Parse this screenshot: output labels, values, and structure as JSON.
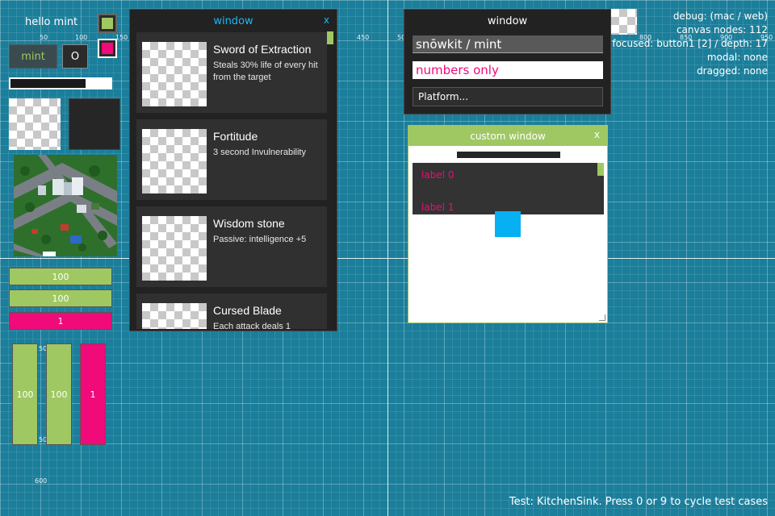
{
  "canvas": {
    "ticks": [
      "50",
      "100",
      "150",
      "450",
      "50",
      "800",
      "850",
      "900",
      "950",
      "50",
      "50",
      "600"
    ]
  },
  "left": {
    "hello_label": "hello mint",
    "check_green": true,
    "check_pink": true,
    "mint_button": "mint",
    "o_button": "O",
    "progress": 0.75,
    "bars_h": [
      "100",
      "100",
      "1"
    ],
    "bars_v": [
      "100",
      "100",
      "1"
    ]
  },
  "list_window": {
    "title": "window",
    "close": "x",
    "items": [
      {
        "name": "Sword of Extraction",
        "desc": "Steals 30% life of every hit from the target"
      },
      {
        "name": "Fortitude",
        "desc": "3 second Invulnerability"
      },
      {
        "name": "Wisdom stone",
        "desc": "Passive: intelligence +5"
      },
      {
        "name": "Cursed Blade",
        "desc": "Each attack deals 1"
      }
    ]
  },
  "form_window": {
    "title": "window",
    "text_field": "snōwkit / mint",
    "numbers_field": "numbers only",
    "dropdown": "Platform..."
  },
  "custom_window": {
    "title": "custom window",
    "close": "x",
    "labels": [
      "label 0",
      "label 1"
    ]
  },
  "debug": {
    "line1": "debug:  (mac / web)",
    "line2": "canvas nodes: 112",
    "line3": "focused: button1 [2] / depth: 17",
    "line4": "modal: none",
    "line5": "dragged: none"
  },
  "footer": "Test: KitchenSink. Press 0 or 9 to cycle test cases",
  "colors": {
    "background": "#1b7e9a",
    "accent_green": "#9fc863",
    "accent_pink": "#f00a7a",
    "accent_blue": "#06b0f2",
    "panel_dark": "#222222"
  }
}
